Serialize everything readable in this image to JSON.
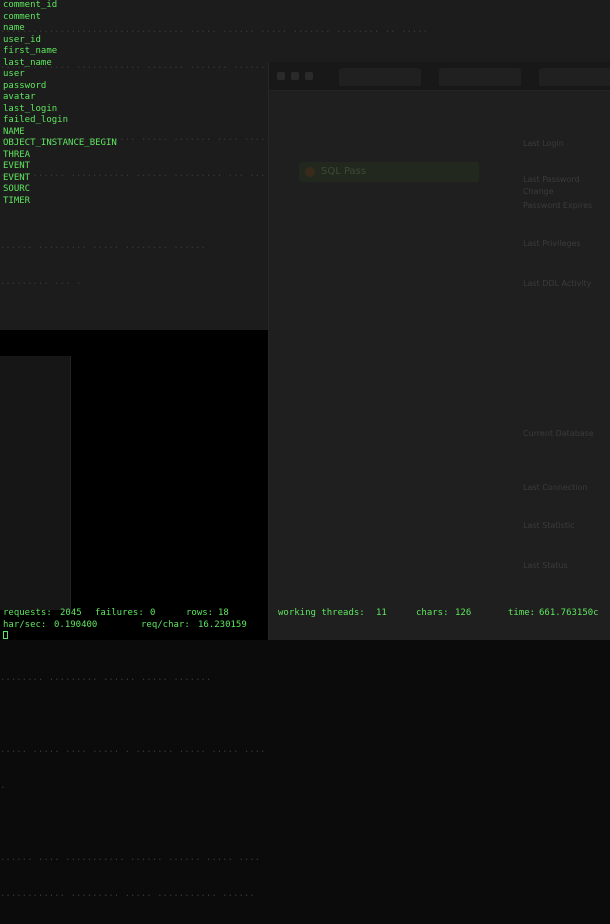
{
  "columns": [
    "comment_id",
    "comment",
    "name",
    "user_id",
    "first_name",
    "last_name",
    "user",
    "password",
    "avatar",
    "last_login",
    "failed_login",
    "NAME",
    "OBJECT_INSTANCE_BEGIN",
    "THREA",
    "EVENT",
    "EVENT",
    "SOURC",
    "TIMER"
  ],
  "status_line1": {
    "requests_label": "requests:",
    "requests_value": "2045",
    "failures_label": "failures:",
    "failures_value": "0",
    "rows_label": "rows:",
    "rows_value": "18",
    "threads_label": "working threads:",
    "threads_value": "11",
    "chars_label": "chars:",
    "chars_value": "126",
    "time_label": "time:",
    "time_value": "661.763150c"
  },
  "status_line2": {
    "charsec_label": "har/sec:",
    "charsec_value": "0.190400",
    "reqchar_label": "req/char:",
    "reqchar_value": "16.230159"
  },
  "background_window": {
    "green_button_label": "SQL Pass",
    "side_labels": [
      "Last Login",
      "Last Password Change",
      "Password Expires",
      "Last Privileges",
      "Last DDL Activity",
      "Current Database",
      "Last Connection",
      "Last Statistic",
      "Last Status"
    ]
  },
  "colors": {
    "terminal_text": "#5ee65e",
    "terminal_background": "#0b0b0b"
  }
}
